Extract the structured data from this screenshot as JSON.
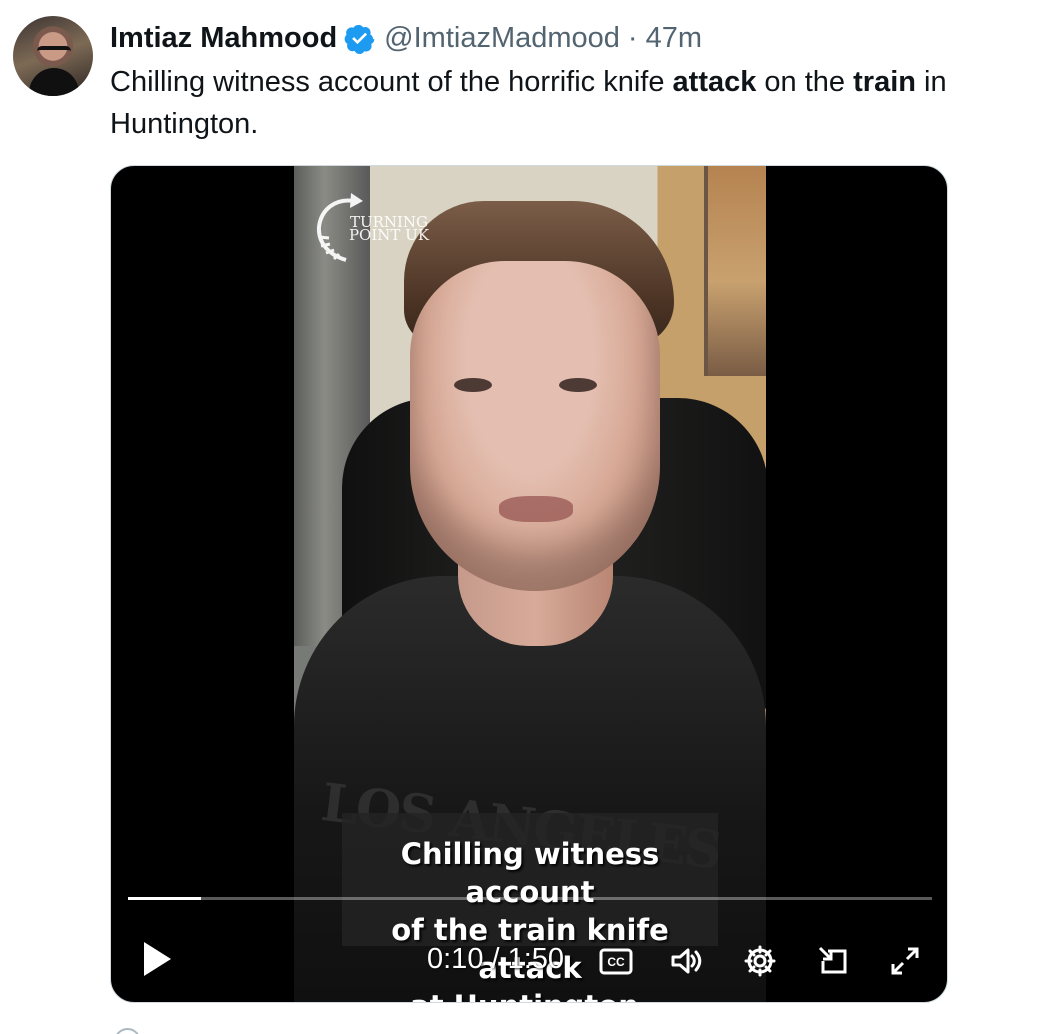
{
  "tweet": {
    "author": {
      "display_name": "Imtiaz Mahmood",
      "handle": "@ImtiazMadmood",
      "separator": "·",
      "time": "47m",
      "avatar_icon": "profile-avatar-icon",
      "verified_icon": "verified-badge-icon"
    },
    "text": {
      "part1": "Chilling witness account of the horrific knife ",
      "bold1": "attack",
      "part2": " on the ",
      "bold2": "train",
      "part3": " in Huntington."
    },
    "media": {
      "type": "video",
      "logo_text": "TURNING\nPOINT UK",
      "shirt_text": "LOS ANGELES",
      "caption": "Chilling witness account\nof the train knife attack\nat Huntington.",
      "time_display": "0:10 / 1:50",
      "progress_fraction": 0.0909,
      "controls": [
        {
          "name": "play-button",
          "icon": "play-icon"
        },
        {
          "name": "closed-captions-button",
          "icon": "cc-icon",
          "label": "CC"
        },
        {
          "name": "volume-button",
          "icon": "volume-icon"
        },
        {
          "name": "settings-button",
          "icon": "gear-icon"
        },
        {
          "name": "picture-in-picture-button",
          "icon": "picture-in-picture-icon"
        },
        {
          "name": "fullscreen-button",
          "icon": "expand-icon"
        }
      ]
    }
  },
  "colors": {
    "text": "#0f1419",
    "secondary_text": "#536471",
    "verified_blue": "#1d9bf0",
    "video_background": "#000000",
    "controls": "#ffffff"
  }
}
